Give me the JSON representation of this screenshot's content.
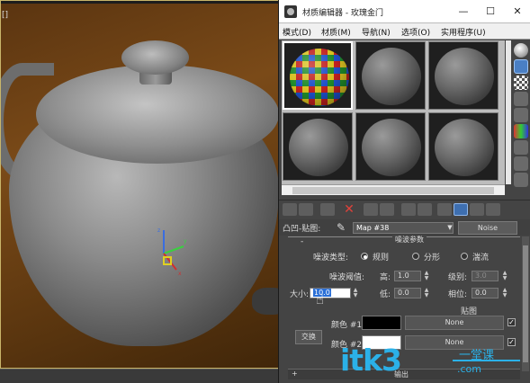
{
  "viewport": {
    "corner_label": "[]"
  },
  "window": {
    "title": "材质编辑器 - 玫瑰金门",
    "controls": {
      "minimize": "—",
      "maximize": "☐",
      "close": "✕"
    }
  },
  "menu": {
    "items": [
      "模式(D)",
      "材质(M)",
      "导航(N)",
      "选项(O)",
      "实用程序(U)"
    ]
  },
  "material_name_row": {
    "label": "凸凹-贴图:",
    "value": "Map #38",
    "type_button": "Noise"
  },
  "noise_params": {
    "rollout_title": "噪波参数",
    "noise_type_label": "噪波类型:",
    "types": [
      "规则",
      "分形",
      "湍流"
    ],
    "selected_type": "规则",
    "threshold_label": "噪波阈值:",
    "high_label": "高:",
    "high_value": "1.0",
    "levels_label": "级别:",
    "levels_value": "3.0",
    "size_label": "大小:",
    "size_value": "10.0",
    "low_label": "低:",
    "low_value": "0.0",
    "phase_label": "相位:",
    "phase_value": "0.0",
    "maps_header": "贴图",
    "color1_label": "颜色 #1",
    "color1_map": "None",
    "color2_label": "颜色 #2",
    "color2_map": "None",
    "swap_label": "交换",
    "next_rollout": "输出",
    "color1": "#000000",
    "color2": "#ffffff"
  },
  "watermark": {
    "main": "itk3",
    "cn": "一堂课",
    "sub": ".com"
  },
  "colors": {
    "accent_blue": "#3e6fb0",
    "watermark": "#2bb1e8",
    "close_red": "#e0413a"
  }
}
